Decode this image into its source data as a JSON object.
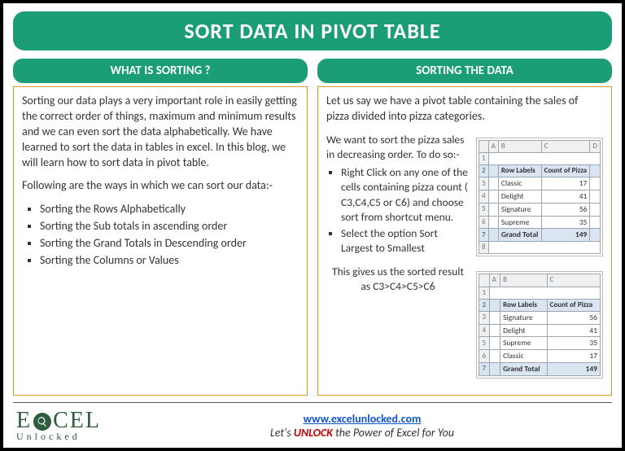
{
  "title": "SORT DATA IN PIVOT TABLE",
  "left": {
    "heading": "WHAT IS SORTING ?",
    "para": "Sorting our data plays a very important role in easily getting the correct order of things, maximum and minimum results and we can even sort the data alphabetically. We have learned to sort the data in tables in excel. In this blog, we will learn how to sort data in pivot table.",
    "intro": "Following are the ways in which we can sort our data:-",
    "bullets": [
      "Sorting the Rows Alphabetically",
      "Sorting the Sub totals in ascending order",
      "Sorting the Grand Totals in Descending order",
      "Sorting the Columns or Values"
    ]
  },
  "right": {
    "heading": "SORTING THE DATA",
    "intro": "Let us say we have a pivot table containing the sales of pizza divided into pizza categories.",
    "p1": "We want to sort the pizza sales in decreasing order. To do so:-",
    "bullets": [
      "Right Click on any one of the cells containing pizza count ( C3,C4,C5 or C6) and choose sort from shortcut menu.",
      "Select the option Sort Largest to Smallest"
    ],
    "p2": "This gives us the sorted result as C3>C4>C5>C6"
  },
  "table1": {
    "h1": "Row Labels",
    "h2": "Count of Pizza",
    "rows": [
      [
        "Classic",
        "17"
      ],
      [
        "Delight",
        "41"
      ],
      [
        "Signature",
        "56"
      ],
      [
        "Supreme",
        "35"
      ]
    ],
    "gt": [
      "Grand Total",
      "149"
    ]
  },
  "table2": {
    "h1": "Row Labels",
    "h2": "Count of Pizza",
    "rows": [
      [
        "Signature",
        "56"
      ],
      [
        "Delight",
        "41"
      ],
      [
        "Supreme",
        "35"
      ],
      [
        "Classic",
        "17"
      ]
    ],
    "gt": [
      "Grand Total",
      "149"
    ]
  },
  "footer": {
    "url": "www.excelunlocked.com",
    "tag1": "Let's ",
    "tag2": "UNLOCK",
    "tag3": " the Power of Excel for You",
    "logo1": "E",
    "logo2": "CEL",
    "logo3": "Unlocked"
  }
}
